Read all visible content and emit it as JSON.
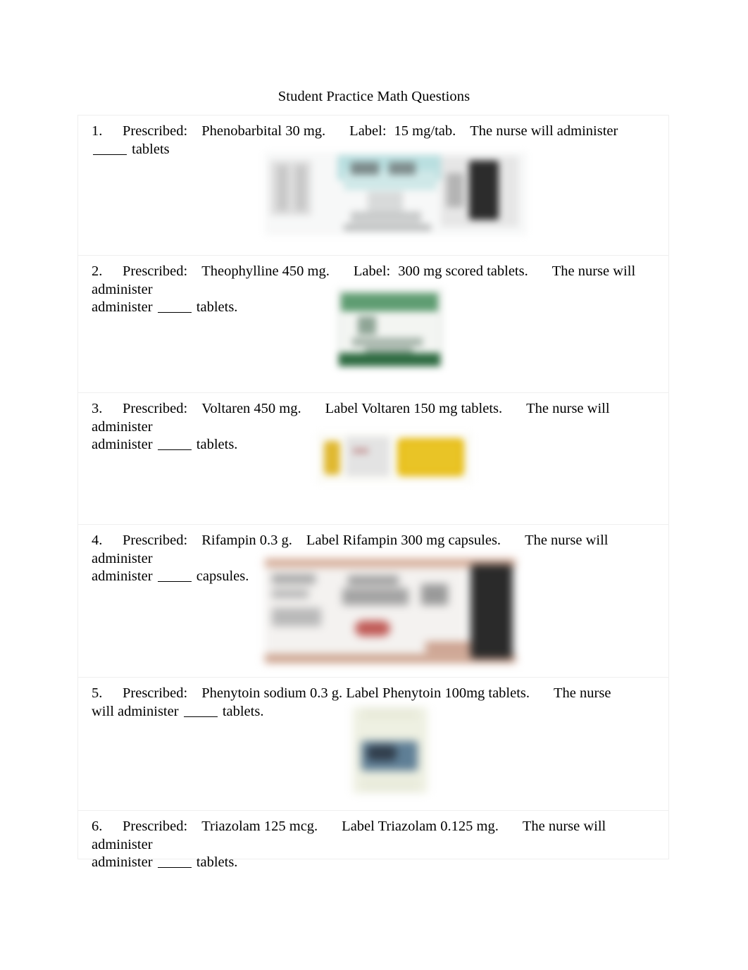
{
  "document": {
    "title": "Student Practice Math Questions",
    "page_background": "#ffffff",
    "text_color": "#000000",
    "table_border_color": "#efefef"
  },
  "questions": [
    {
      "number": "1.",
      "line1_prefix": "Prescribed:",
      "drug_order": "Phenobarbital 30 mg.",
      "label_prefix": "Label:",
      "label_value": "15 mg/tab.",
      "instruction_before": "The nurse will administer",
      "instruction_after": "tablets",
      "image": {
        "name": "phenobarbital-label-image",
        "description": "blurred white medication label with teal banner and dark side panel",
        "accent_color": "#b9dfe0"
      }
    },
    {
      "number": "2.",
      "line1_prefix": "Prescribed:",
      "drug_order": "Theophylline 450 mg.",
      "label_prefix": "Label:",
      "label_value": "300 mg scored tablets.",
      "instruction_before": "The nurse will administer",
      "instruction_after": "tablets.",
      "image": {
        "name": "theophylline-label-image",
        "description": "blurred green-bordered medication carton",
        "accent_color": "#5f9d72"
      }
    },
    {
      "number": "3.",
      "line1_prefix": "Prescribed:",
      "drug_order": "Voltaren 450 mg.",
      "label_prefix": "Label",
      "label_value": "Voltaren 150 mg tablets.",
      "instruction_before": "The nurse will administer",
      "instruction_after": "tablets.",
      "image": {
        "name": "voltaren-label-image",
        "description": "blurred yellow and gold medication package",
        "accent_color": "#e8bc12"
      }
    },
    {
      "number": "4.",
      "line1_prefix": "Prescribed:",
      "drug_order": "Rifampin 0.3 g.",
      "label_prefix": "Label",
      "label_value": "Rifampin 300 mg capsules.",
      "instruction_before": "The nurse will administer",
      "instruction_after": "capsules.",
      "image": {
        "name": "rifampin-label-image",
        "description": "blurred wide medication label with salmon borders, red oval and dark panel",
        "accent_color": "#d3a893"
      }
    },
    {
      "number": "5.",
      "line1_prefix": "Prescribed:",
      "drug_order": "Phenytoin sodium 0.3 g.",
      "label_prefix": "Label",
      "label_value": "Phenytoin 100mg tablets.",
      "instruction_before": "The nurse will administer",
      "instruction_after": "tablets.",
      "image": {
        "name": "phenytoin-label-image",
        "description": "blurred pale cream bottle with blue-gray label",
        "accent_color": "#5f7f96"
      }
    },
    {
      "number": "6.",
      "line1_prefix": "Prescribed:",
      "drug_order": "Triazolam 125 mcg.",
      "label_prefix": "Label",
      "label_value": "Triazolam 0.125 mg.",
      "instruction_before": "The nurse will administer",
      "instruction_after": "tablets.",
      "image": null
    }
  ]
}
